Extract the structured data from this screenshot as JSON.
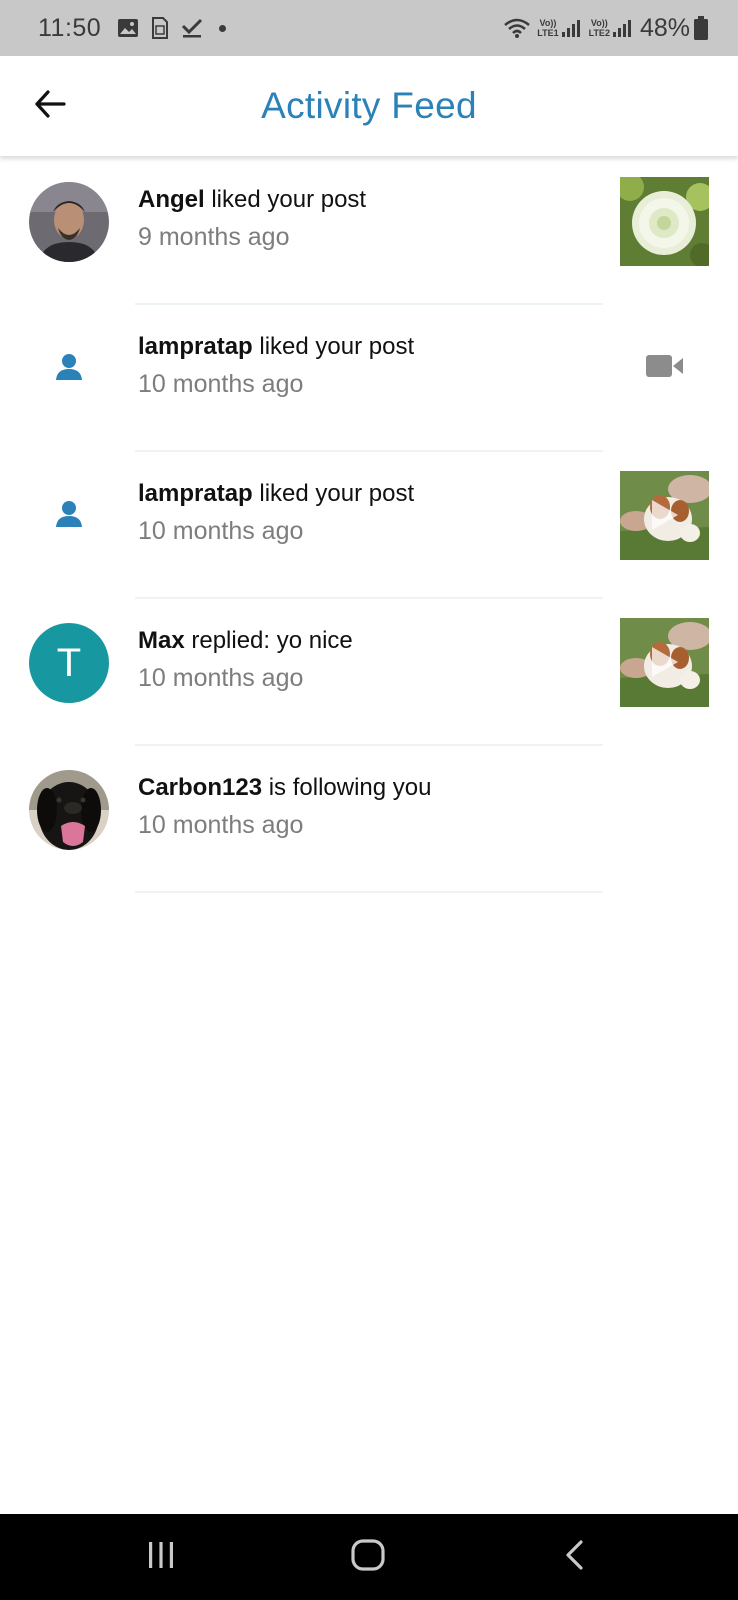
{
  "status_bar": {
    "time": "11:50",
    "sim1_label": "Vo)) LTE1",
    "sim2_label": "Vo)) LTE2",
    "sim1_top": "Vo))",
    "sim1_bottom": "LTE1",
    "sim2_top": "Vo))",
    "sim2_bottom": "LTE2",
    "battery": "48%",
    "icons": [
      "gallery-icon",
      "sim-card-icon",
      "checkmark-icon",
      "notification-dot-icon",
      "wifi-icon",
      "signal-icon",
      "battery-icon"
    ]
  },
  "header": {
    "title": "Activity Feed",
    "back_icon": "arrow-left-icon",
    "title_color": "#2a82b8"
  },
  "feed": {
    "items": [
      {
        "username": "Angel",
        "action": " liked your post",
        "time": "9 months ago",
        "avatar": "photo",
        "thumbnail": "flower-photo"
      },
      {
        "username": "lampratap",
        "action": " liked your post",
        "time": "10 months ago",
        "avatar": "person-icon",
        "thumbnail": "video-camera-icon"
      },
      {
        "username": "lampratap",
        "action": " liked your post",
        "time": "10 months ago",
        "avatar": "person-icon",
        "thumbnail": "puppy-video-thumbnail"
      },
      {
        "username": "Max",
        "action": " replied: yo nice",
        "time": "10 months ago",
        "avatar_letter": "T",
        "avatar_color": "#17979f",
        "thumbnail": "puppy-video-thumbnail"
      },
      {
        "username": "Carbon123",
        "action": " is following you",
        "time": "10 months ago",
        "avatar": "dog-photo"
      }
    ]
  },
  "nav_bar": {
    "buttons": [
      "recent-apps-icon",
      "home-icon",
      "back-icon"
    ]
  }
}
